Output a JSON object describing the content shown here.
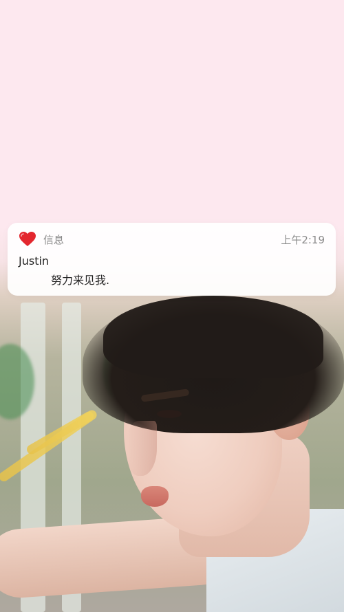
{
  "notification": {
    "app_name": "信息",
    "time": "上午2:19",
    "sender": "Justin",
    "message": "努力来见我.",
    "app_icon": "heart-icon"
  },
  "colors": {
    "background_pink": "#fde8ef",
    "heart_red": "#e3262e",
    "meta_gray": "#8a8a8a"
  }
}
